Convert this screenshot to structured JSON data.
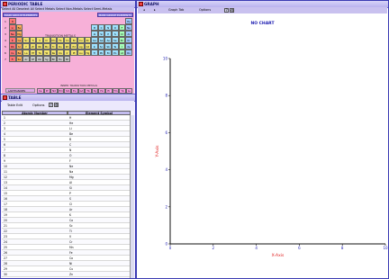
{
  "periodic": {
    "title": "PERIODIC TABLE",
    "toolbar_text": "Select All Deselect All Select Metals Select Non-Metals Select Semi-Metals",
    "main_group_left": "MAIN GROUP ELEMENTS",
    "main_group_right": "MAIN GROUP ELEMENTS",
    "transition_label": "TRANSITION METALS",
    "inner_transition_label": "INNER TRANSITION METALS",
    "lanthanides_label": "LANTHANIDES",
    "actinides_label": "ACTINIDES",
    "rows": [
      [
        "H",
        "",
        "",
        "",
        "",
        "",
        "",
        "",
        "",
        "",
        "",
        "",
        "",
        "",
        "",
        "",
        "",
        "He"
      ],
      [
        "Li",
        "Be",
        "",
        "",
        "",
        "",
        "",
        "",
        "",
        "",
        "",
        "",
        "B",
        "C",
        "N",
        "O",
        "F",
        "Ne"
      ],
      [
        "Na",
        "Mg",
        "",
        "",
        "",
        "",
        "",
        "",
        "",
        "",
        "",
        "",
        "Al",
        "Si",
        "P",
        "S",
        "Cl",
        "Ar"
      ],
      [
        "K",
        "Ca",
        "Sc",
        "Ti",
        "V",
        "Cr",
        "Mn",
        "Fe",
        "Co",
        "Ni",
        "Cu",
        "Zn",
        "Ga",
        "Ge",
        "As",
        "Se",
        "Br",
        "Kr"
      ],
      [
        "Rb",
        "Sr",
        "Y",
        "Zr",
        "Nb",
        "Mo",
        "Tc",
        "Ru",
        "Rh",
        "Pd",
        "Ag",
        "Cd",
        "In",
        "Sn",
        "Sb",
        "Te",
        "I",
        "Xe"
      ],
      [
        "Cs",
        "Ba",
        "La",
        "Hf",
        "Ta",
        "W",
        "Re",
        "Os",
        "Ir",
        "Pt",
        "Au",
        "Hg",
        "Tl",
        "Pb",
        "Bi",
        "Po",
        "At",
        "Rn"
      ],
      [
        "Fr",
        "Ra",
        "Ac",
        "Rf",
        "Db",
        "Sg",
        "Bh",
        "Hs",
        "Mt",
        "",
        "",
        "",
        "",
        "",
        "",
        "",
        "",
        ""
      ]
    ],
    "lanthanides": [
      "Ce",
      "Pr",
      "Nd",
      "Pm",
      "Sm",
      "Eu",
      "Gd",
      "Tb",
      "Dy",
      "Ho",
      "Er",
      "Tm",
      "Yb",
      "Lu"
    ],
    "actinides": [
      "Th",
      "Pa",
      "U",
      "Np",
      "Pu",
      "Am",
      "Cm",
      "Bk",
      "Cf",
      "Es",
      "Fm",
      "Md",
      "No",
      "Lr"
    ]
  },
  "table": {
    "title": "TABLE",
    "toolbar_a": "Table Edit",
    "toolbar_b": "Options",
    "col_atomic": "Atomic Number",
    "col_symbol": "Element Symbol",
    "rows": [
      [
        "1",
        "H"
      ],
      [
        "2",
        "He"
      ],
      [
        "3",
        "Li"
      ],
      [
        "4",
        "Be"
      ],
      [
        "5",
        "B"
      ],
      [
        "6",
        "C"
      ],
      [
        "7",
        "N"
      ],
      [
        "8",
        "O"
      ],
      [
        "9",
        "F"
      ],
      [
        "10",
        "Ne"
      ],
      [
        "11",
        "Na"
      ],
      [
        "12",
        "Mg"
      ],
      [
        "13",
        "Al"
      ],
      [
        "14",
        "Si"
      ],
      [
        "15",
        "P"
      ],
      [
        "16",
        "S"
      ],
      [
        "17",
        "Cl"
      ],
      [
        "18",
        "Ar"
      ],
      [
        "19",
        "K"
      ],
      [
        "20",
        "Ca"
      ],
      [
        "21",
        "Sc"
      ],
      [
        "22",
        "Ti"
      ],
      [
        "23",
        "V"
      ],
      [
        "24",
        "Cr"
      ],
      [
        "25",
        "Mn"
      ],
      [
        "26",
        "Fe"
      ],
      [
        "27",
        "Co"
      ],
      [
        "28",
        "Ni"
      ],
      [
        "29",
        "Cu"
      ],
      [
        "30",
        "Zn"
      ]
    ]
  },
  "graph": {
    "title": "GRAPH",
    "toolbar_a": "Graph Tab",
    "toolbar_b": "Options",
    "message": "NO CHART"
  },
  "chart_data": {
    "type": "scatter",
    "title": "NO CHART",
    "xlabel": "X-Axis",
    "ylabel": "Y-Axis",
    "xlim": [
      0,
      10
    ],
    "ylim": [
      0,
      10
    ],
    "xticks": [
      "0",
      "2",
      "4",
      "6",
      "8",
      "10"
    ],
    "yticks": [
      "0",
      "2",
      "4",
      "6",
      "8",
      "10"
    ],
    "series": []
  }
}
